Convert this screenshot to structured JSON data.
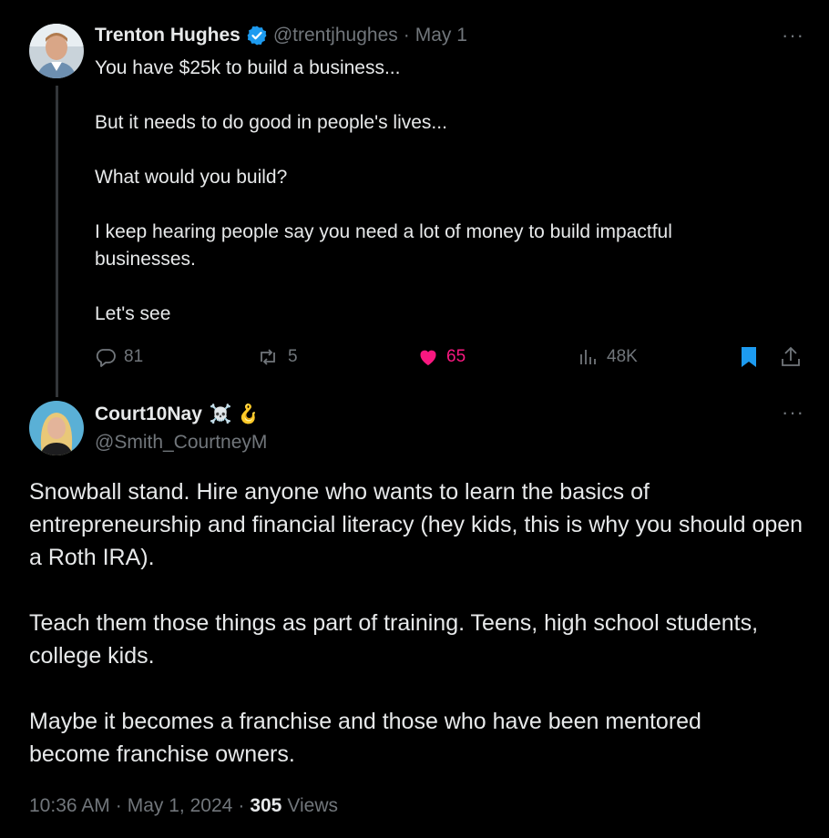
{
  "tweet": {
    "author": {
      "name": "Trenton Hughes",
      "handle": "@trentjhughes",
      "date": "May 1",
      "separator": "·"
    },
    "lines": [
      "You have $25k to build a business...",
      "But it needs to do good in people's lives...",
      "What would you build?",
      "I keep hearing people say you need a lot of money to build impactful businesses.",
      "Let's see"
    ],
    "actions": {
      "replies": "81",
      "reposts": "5",
      "likes": "65",
      "views": "48K"
    },
    "more": "···"
  },
  "reply": {
    "author": {
      "name": "Court10Nay",
      "emoji": "☠️ 🪝",
      "handle": "@Smith_CourtneyM"
    },
    "paragraphs": [
      "Snowball stand. Hire anyone who wants to learn the basics of entrepreneurship and financial literacy (hey kids, this is why you should open a Roth IRA).",
      "Teach them those things as part of training. Teens, high school students, college kids.",
      "Maybe it becomes a franchise and those who have been mentored become franchise owners."
    ],
    "time": "10:36 AM",
    "date": "May 1, 2024",
    "separator1": "·",
    "separator2": "·",
    "views_count": "305",
    "views_label": "Views",
    "more": "···"
  },
  "colors": {
    "background": "#000000",
    "text": "#e7e9ea",
    "muted": "#71767b",
    "like": "#f91880",
    "verified": "#1d9bf0",
    "bookmark": "#1d9bf0"
  }
}
